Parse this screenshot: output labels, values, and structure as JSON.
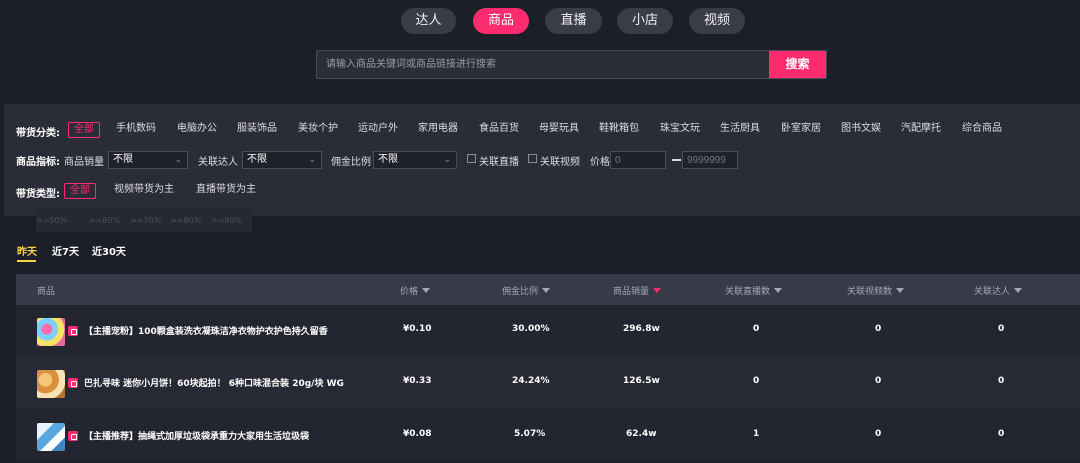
{
  "nav_tabs": [
    {
      "label": "达人",
      "active": false
    },
    {
      "label": "商品",
      "active": true
    },
    {
      "label": "直播",
      "active": false
    },
    {
      "label": "小店",
      "active": false
    },
    {
      "label": "视频",
      "active": false
    }
  ],
  "search": {
    "placeholder": "请输入商品关键词或商品链接进行搜索",
    "button_label": "搜索"
  },
  "filters": {
    "category": {
      "label": "带货分类:",
      "options": [
        "全部",
        "手机数码",
        "电脑办公",
        "服装饰品",
        "美妆个护",
        "运动户外",
        "家用电器",
        "食品百货",
        "母婴玩具",
        "鞋靴箱包",
        "珠宝文玩",
        "生活厨具",
        "卧室家居",
        "图书文娱",
        "汽配摩托",
        "综合商品"
      ],
      "selected": "全部"
    },
    "metrics": {
      "label": "商品指标:",
      "sales_label": "商品销量",
      "sales_value": "不限",
      "influencer_label": "关联达人",
      "influencer_value": "不限",
      "commission_label": "佣金比例",
      "commission_value": "不限",
      "live_checkbox": "关联直播",
      "video_checkbox": "关联视频",
      "price_label": "价格",
      "price_min_placeholder": "0",
      "price_max_placeholder": "9999999"
    },
    "type": {
      "label": "带货类型:",
      "options": [
        "全部",
        "视频带货为主",
        "直播带货为主"
      ],
      "selected": "全部"
    },
    "ghost_options": [
      ">=50%",
      ">=60%",
      ">=70%",
      ">=80%",
      ">=90%"
    ]
  },
  "period_tabs": [
    {
      "label": "昨天",
      "active": true
    },
    {
      "label": "近7天",
      "active": false
    },
    {
      "label": "近30天",
      "active": false
    }
  ],
  "table": {
    "columns": [
      "商品",
      "价格",
      "佣金比例",
      "商品销量",
      "关联直播数",
      "关联视频数",
      "关联达人"
    ],
    "sorted_column": "商品销量",
    "rows": [
      {
        "name": "【主播宠粉】100颗盒装洗衣凝珠洁净衣物护衣护色持久留香",
        "price": "¥0.10",
        "commission": "30.00%",
        "sales": "296.8w",
        "lives": "0",
        "videos": "0",
        "influencers": "0"
      },
      {
        "name": "巴扎寻味 迷你小月饼！60块起拍！ 6种口味混合装 20g/块 WG",
        "price": "¥0.33",
        "commission": "24.24%",
        "sales": "126.5w",
        "lives": "0",
        "videos": "0",
        "influencers": "0"
      },
      {
        "name": "【主播推荐】抽绳式加厚垃圾袋承重力大家用生活垃圾袋",
        "price": "¥0.08",
        "commission": "5.07%",
        "sales": "62.4w",
        "lives": "1",
        "videos": "0",
        "influencers": "0"
      }
    ]
  },
  "colors": {
    "accent": "#fe2c6e",
    "period_active": "#ffd24a",
    "background": "#1d1f28"
  }
}
